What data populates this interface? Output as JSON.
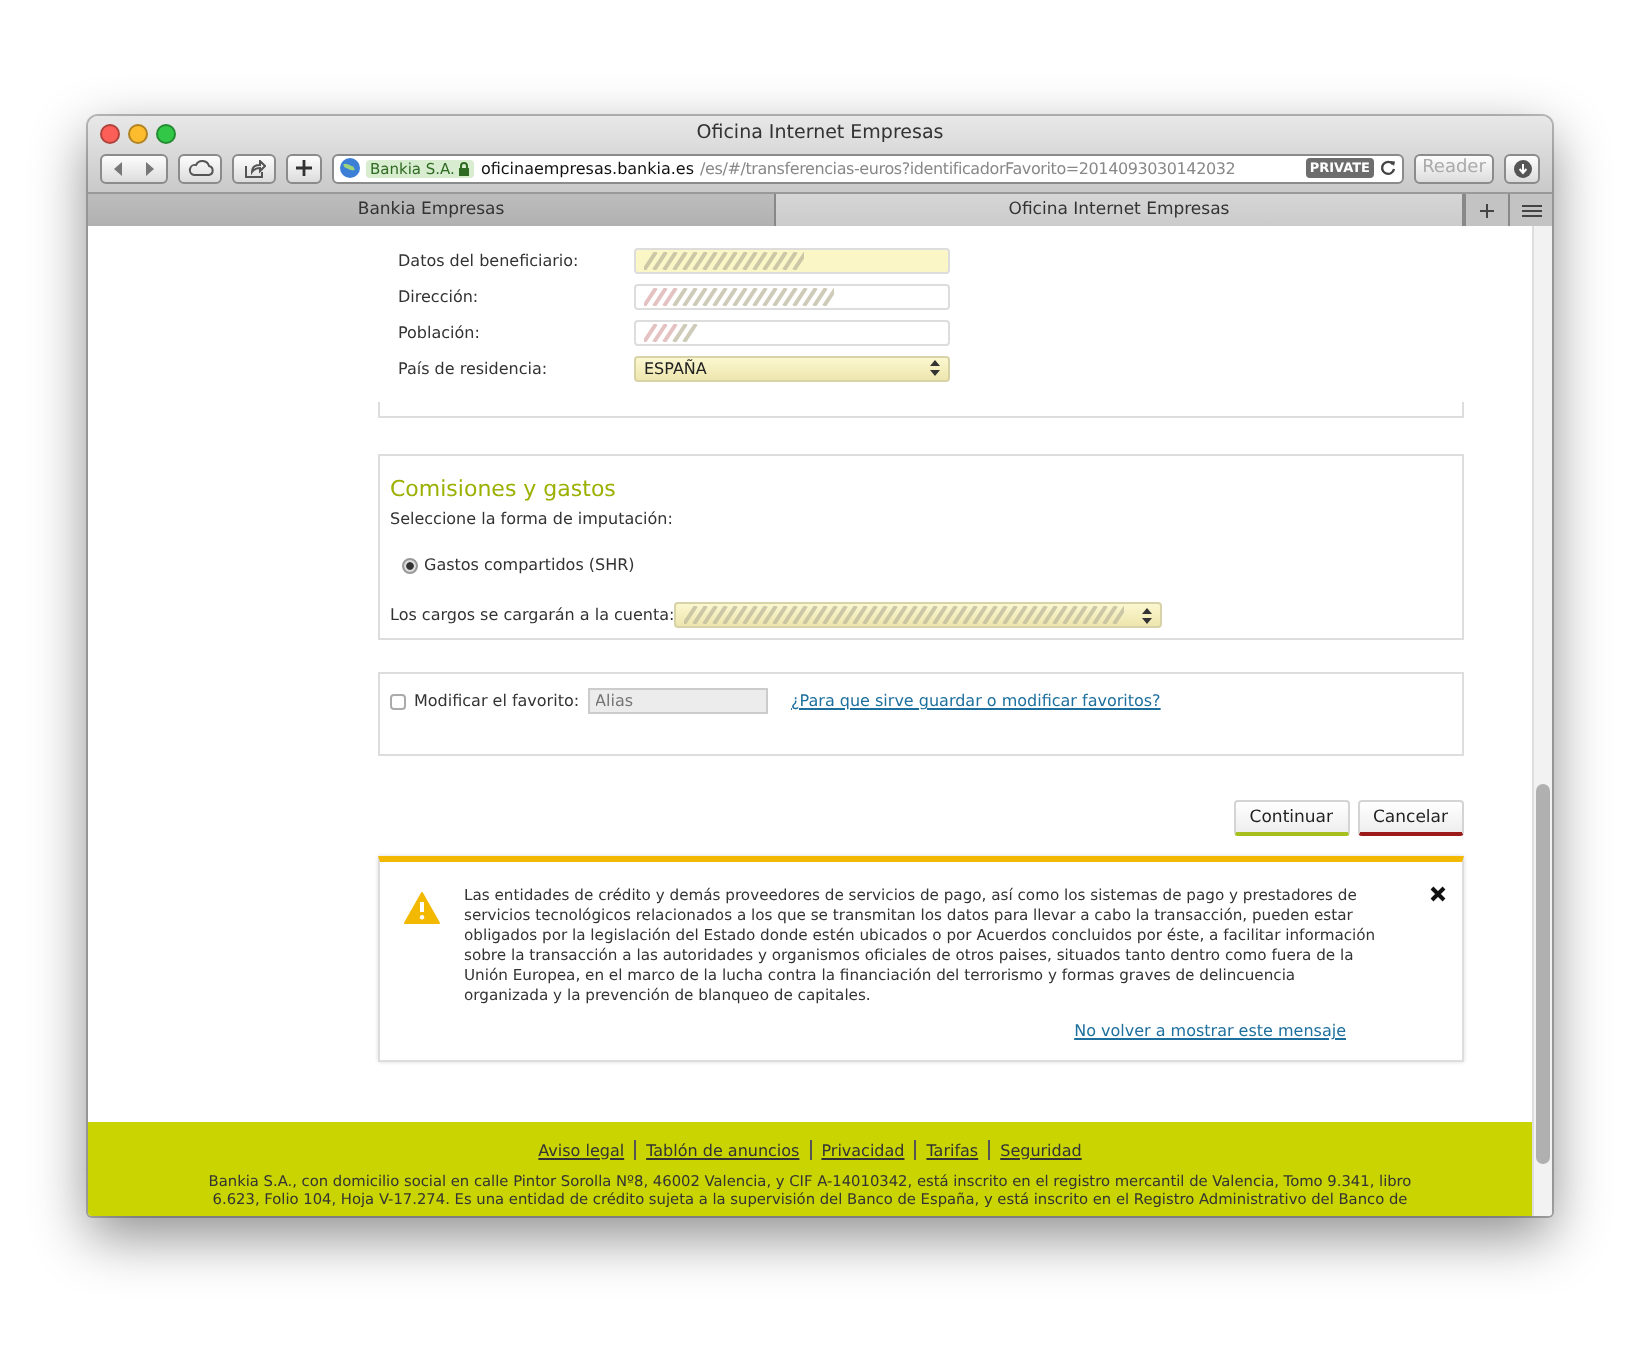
{
  "window": {
    "title": "Oficina Internet Empresas"
  },
  "toolbar": {
    "site_badge": "Bankia S.A.",
    "url_host": "oficinaempresas.bankia.es",
    "url_path": "/es/#/transferencias-euros?identificadorFavorito=2014093030142032",
    "private_badge": "PRIVATE",
    "reader_button": "Reader"
  },
  "tabs": [
    {
      "label": "Bankia Empresas",
      "selected": false
    },
    {
      "label": "Oficina Internet Empresas",
      "selected": true
    }
  ],
  "beneficiary": {
    "fields": [
      {
        "label": "Datos del beneficiario:",
        "kind": "text",
        "highlighted": true
      },
      {
        "label": "Dirección:",
        "kind": "text",
        "highlighted": false
      },
      {
        "label": "Población:",
        "kind": "text",
        "highlighted": false
      },
      {
        "label": "País de residencia:",
        "kind": "select",
        "highlighted": true,
        "value": "ESPAÑA"
      }
    ]
  },
  "commissions": {
    "title": "Comisiones y gastos",
    "prompt": "Seleccione la forma de imputación:",
    "options": [
      {
        "label": "Gastos compartidos (SHR)",
        "selected": true
      }
    ],
    "account_label": "Los cargos se cargarán a la cuenta:"
  },
  "favorite": {
    "label": "Modificar el favorito:",
    "checked": false,
    "alias_placeholder": "Alias",
    "help_link": "¿Para que sirve guardar o modificar favoritos?"
  },
  "buttons": [
    {
      "label": "Continuar",
      "kind": "primary"
    },
    {
      "label": "Cancelar",
      "kind": "cancel"
    }
  ],
  "notice": {
    "text": "Las entidades de crédito y demás proveedores de servicios de pago, así como los sistemas de pago y prestadores de servicios tecnológicos relacionados a los que se transmitan los datos para llevar a cabo la transacción, pueden estar obligados por la legislación del Estado donde estén ubicados o por Acuerdos concluidos por éste, a facilitar información sobre la transacción a las autoridades y organismos oficiales de otros paises, situados tanto dentro como fuera de la Unión Europea, en el marco de la lucha contra la financiación del terrorismo y formas graves de delincuencia organizada y la prevención de blanqueo de capitales.",
    "dismiss_link": "No volver a mostrar este mensaje"
  },
  "footer": {
    "links": [
      "Aviso legal",
      "Tablón de anuncios",
      "Privacidad",
      "Tarifas",
      "Seguridad"
    ],
    "legal_lines": [
      "Bankia S.A., con domicilio social en calle Pintor Sorolla Nº8, 46002 Valencia, y CIF A-14010342, está inscrito en el registro mercantil de Valencia, Tomo 9.341, libro",
      "6.623, Folio 104, Hoja V-17.274. Es una entidad de crédito sujeta a la supervisión del Banco de España, y está inscrito en el Registro Administrativo del Banco de"
    ]
  }
}
